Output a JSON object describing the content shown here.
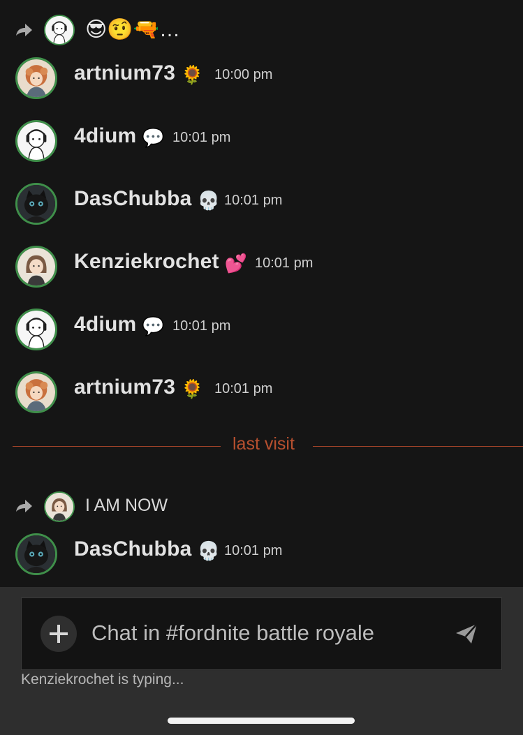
{
  "reply_top": {
    "text": "😎🤨🔫…",
    "avatar": "4dium-avatar"
  },
  "messages": [
    {
      "username": "artnium73",
      "badge": "🌻",
      "time": "10:00 pm",
      "avatar": "artnium73-avatar"
    },
    {
      "username": "4dium",
      "badge": "💬",
      "time": "10:01 pm",
      "avatar": "4dium-avatar"
    },
    {
      "username": "DasChubba",
      "badge": "💀",
      "time": "10:01 pm",
      "avatar": "daschubba-avatar"
    },
    {
      "username": "Kenziekrochet",
      "badge": "💕",
      "time": "10:01 pm",
      "avatar": "kenziekrochet-avatar"
    },
    {
      "username": "4dium",
      "badge": "💬",
      "time": "10:01 pm",
      "avatar": "4dium-avatar"
    },
    {
      "username": "artnium73",
      "badge": "🌻",
      "time": "10:01 pm",
      "avatar": "artnium73-avatar"
    }
  ],
  "divider_label": "last visit",
  "reply_bottom": {
    "text": "I AM NOW",
    "avatar": "kenziekrochet-avatar"
  },
  "last_message": {
    "username": "DasChubba",
    "badge": "💀",
    "time": "10:01 pm",
    "avatar": "daschubba-avatar"
  },
  "composer": {
    "placeholder": "Chat in #fordnite battle royale",
    "typing_indicator": "Kenziekrochet is typing..."
  },
  "colors": {
    "background": "#151515",
    "avatar_ring": "#3f8f4a",
    "divider": "#b8502f",
    "composer_bg": "#2e2e2e"
  }
}
